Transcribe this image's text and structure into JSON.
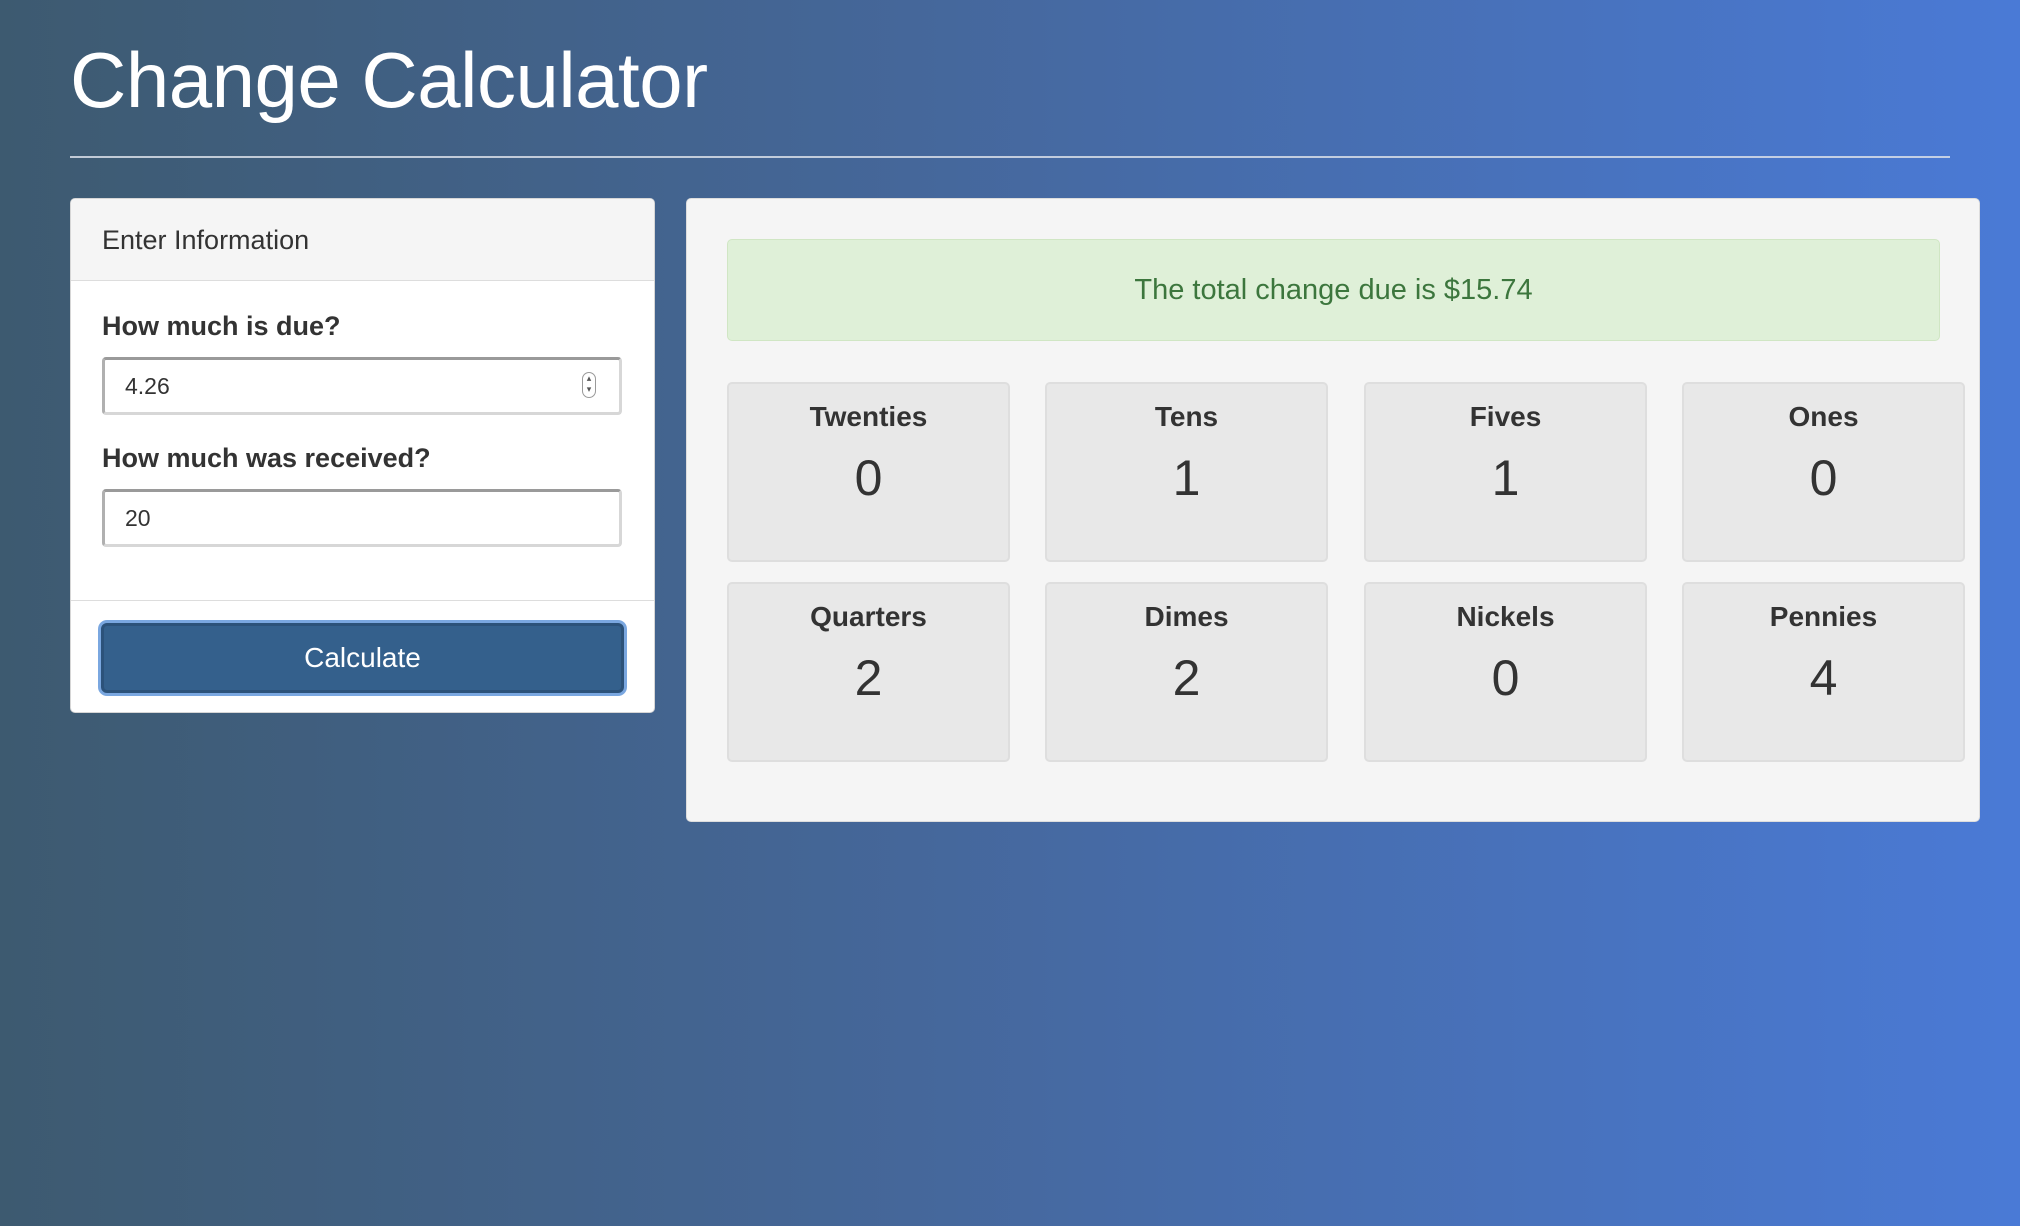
{
  "header": {
    "title": "Change Calculator"
  },
  "form": {
    "panel_title": "Enter Information",
    "due_label": "How much is due?",
    "due_value": "4.26",
    "received_label": "How much was received?",
    "received_value": "20",
    "calculate_label": "Calculate"
  },
  "results": {
    "total_message": "The total change due is $15.74",
    "denominations": [
      {
        "name": "Twenties",
        "count": "0"
      },
      {
        "name": "Tens",
        "count": "1"
      },
      {
        "name": "Fives",
        "count": "1"
      },
      {
        "name": "Ones",
        "count": "0"
      },
      {
        "name": "Quarters",
        "count": "2"
      },
      {
        "name": "Dimes",
        "count": "2"
      },
      {
        "name": "Nickels",
        "count": "0"
      },
      {
        "name": "Pennies",
        "count": "4"
      }
    ]
  },
  "colors": {
    "button": "#34608c",
    "alert_background": "#dff0d8",
    "alert_text": "#3c763d"
  },
  "icons": {
    "number_spinner": "spinner-arrows-icon"
  }
}
